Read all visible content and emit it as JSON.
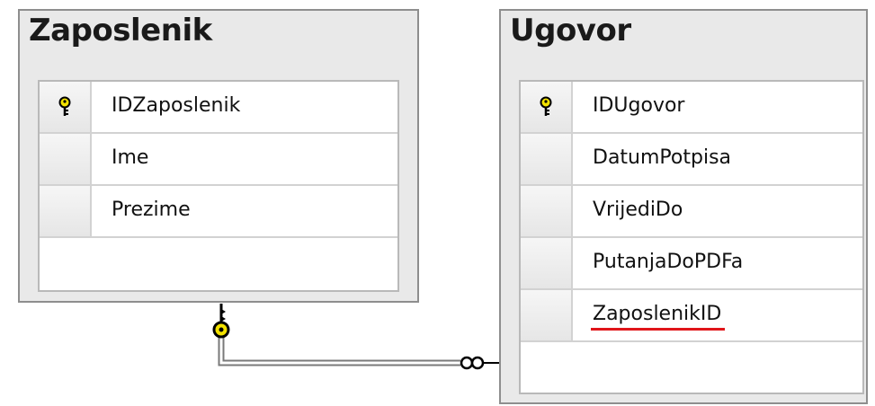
{
  "tables": [
    {
      "name": "Zaposlenik",
      "columns": [
        {
          "label": "IDZaposlenik",
          "primary_key": true
        },
        {
          "label": "Ime",
          "primary_key": false
        },
        {
          "label": "Prezime",
          "primary_key": false
        }
      ]
    },
    {
      "name": "Ugovor",
      "columns": [
        {
          "label": "IDUgovor",
          "primary_key": true
        },
        {
          "label": "DatumPotpisa",
          "primary_key": false
        },
        {
          "label": "VrijediDo",
          "primary_key": false
        },
        {
          "label": "PutanjaDoPDFa",
          "primary_key": false
        },
        {
          "label": "ZaposlenikID",
          "primary_key": false,
          "spellcheck_flag": true
        }
      ]
    }
  ],
  "relationship": {
    "from_table": "Zaposlenik",
    "to_table": "Ugovor",
    "from_end": "one (key)",
    "to_end": "many (infinity)"
  },
  "colors": {
    "key_yellow": "#f3e200",
    "spellcheck_red": "#e0151a",
    "table_border": "#8e8e8e"
  }
}
